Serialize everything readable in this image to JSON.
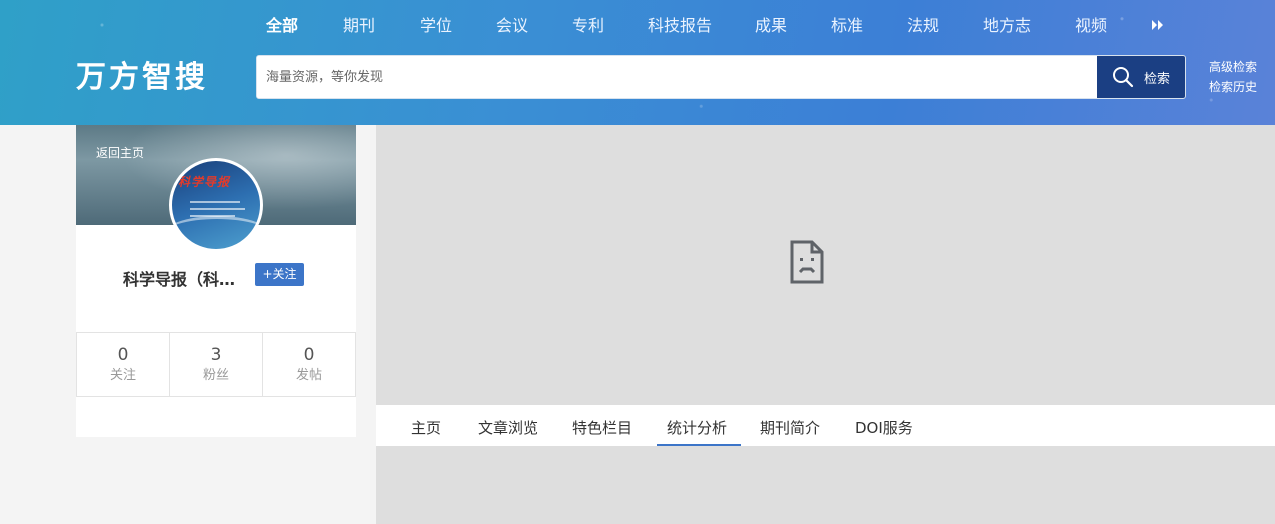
{
  "header": {
    "logo": "万方智搜",
    "nav": [
      {
        "label": "全部",
        "active": true
      },
      {
        "label": "期刊"
      },
      {
        "label": "学位"
      },
      {
        "label": "会议"
      },
      {
        "label": "专利"
      },
      {
        "label": "科技报告"
      },
      {
        "label": "成果"
      },
      {
        "label": "标准"
      },
      {
        "label": "法规"
      },
      {
        "label": "地方志"
      },
      {
        "label": "视频"
      }
    ],
    "more_icon": "double-chevron-right-icon",
    "search": {
      "placeholder": "海量资源，等你发现",
      "value": "",
      "button_label": "检索"
    },
    "advanced_search": "高级检索",
    "search_history": "检索历史",
    "colors": {
      "search_button": "#1b3f83",
      "accent": "#3c75c8"
    }
  },
  "profile": {
    "back_home": "返回主页",
    "journal_name": "科学导报（科…",
    "avatar_cover_title": "科学导报",
    "follow_label": "+关注",
    "stats": [
      {
        "num": "0",
        "label": "关注"
      },
      {
        "num": "3",
        "label": "粉丝"
      },
      {
        "num": "0",
        "label": "发帖"
      }
    ]
  },
  "main": {
    "broken_image_icon": "broken-page-icon",
    "tabs": [
      {
        "label": "主页"
      },
      {
        "label": "文章浏览"
      },
      {
        "label": "特色栏目"
      },
      {
        "label": "统计分析",
        "active": true
      },
      {
        "label": "期刊简介"
      },
      {
        "label": "DOI服务"
      }
    ]
  }
}
